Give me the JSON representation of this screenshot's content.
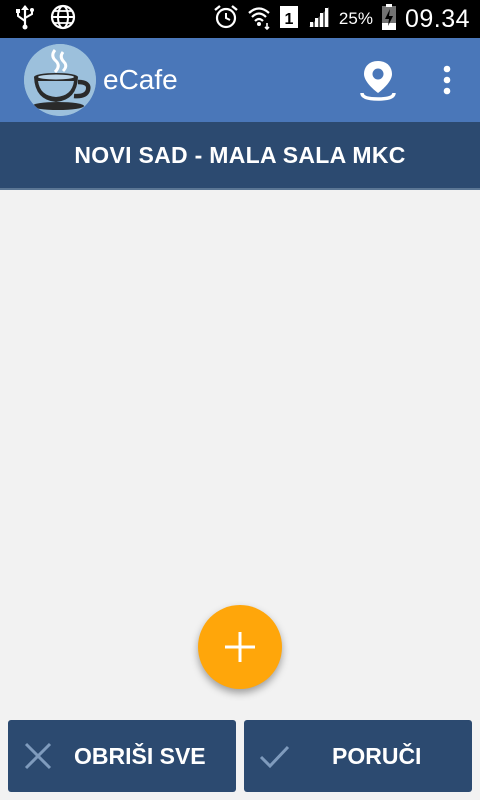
{
  "status_bar": {
    "battery": "25%",
    "time": "09.34",
    "sim_slot": "1",
    "icons": [
      "usb-icon",
      "globe-icon",
      "alarm-icon",
      "wifi-icon",
      "sim-icon",
      "signal-icon",
      "battery-charging-icon"
    ]
  },
  "app_bar": {
    "title": "eCafe",
    "logo_icon": "coffee-cup-logo",
    "actions": [
      "location-pin-icon",
      "more-vert-icon"
    ],
    "color": "#4a77b9"
  },
  "location": {
    "name": "NOVI SAD - MALA SALA MKC"
  },
  "fab": {
    "icon": "plus-icon",
    "color": "#ffa60a"
  },
  "actions": {
    "clear_label": "OBRIŠI SVE",
    "clear_icon": "close-icon",
    "order_label": "PORUČI",
    "order_icon": "check-icon",
    "color": "#2c4a70"
  }
}
